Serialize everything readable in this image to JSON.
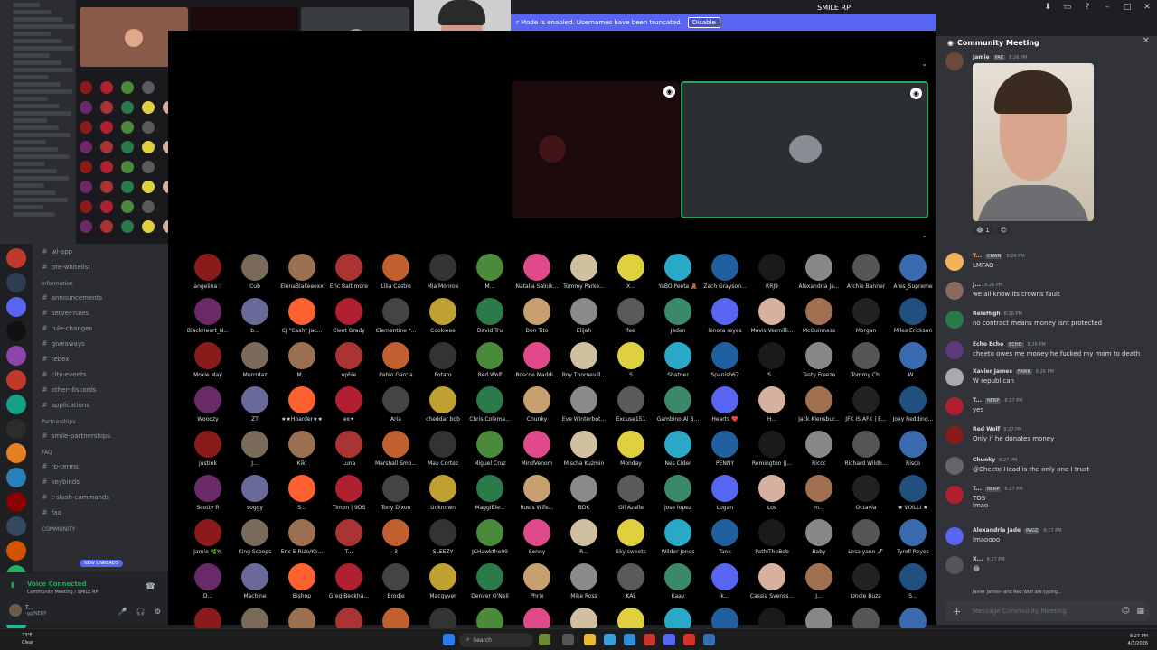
{
  "titlebar": {
    "title": "SMILE RP"
  },
  "streamer_banner": {
    "text": "r Mode is enabled. Usernames have been truncated.",
    "button": "Disable"
  },
  "channels": {
    "items": [
      {
        "name": "wl-app",
        "kind": "ch"
      },
      {
        "name": "pre-whitelist",
        "kind": "ch"
      },
      {
        "name": "Information",
        "kind": "cat"
      },
      {
        "name": "announcements",
        "kind": "ch"
      },
      {
        "name": "server-rules",
        "kind": "ch"
      },
      {
        "name": "rule-changes",
        "kind": "ch"
      },
      {
        "name": "giveaways",
        "kind": "ch"
      },
      {
        "name": "tebex",
        "kind": "ch"
      },
      {
        "name": "city-events",
        "kind": "ch"
      },
      {
        "name": "other-discords",
        "kind": "ch"
      },
      {
        "name": "applications",
        "kind": "ch"
      },
      {
        "name": "Partnerships",
        "kind": "cat"
      },
      {
        "name": "smile-partnerships",
        "kind": "ch"
      },
      {
        "name": "FAQ",
        "kind": "cat"
      },
      {
        "name": "rp-terms",
        "kind": "ch"
      },
      {
        "name": "keybinds",
        "kind": "ch"
      },
      {
        "name": "t-slash-commands",
        "kind": "ch"
      },
      {
        "name": "faq",
        "kind": "ch"
      },
      {
        "name": "COMMUNITY",
        "kind": "cat"
      }
    ],
    "new_unreads": "NEW UNREADS"
  },
  "voice": {
    "status": "Voice Connected",
    "channel": "Community Meeting / SMILE RP",
    "user": "T...",
    "user_sub": "-gg/NERP"
  },
  "participants": [
    "angelina♡",
    "Cub",
    "ElenaBlakeeexx",
    "Eric Baltimore",
    "Lilia Castro",
    "Mia Monroe",
    "M...",
    "Natalia Salnik...",
    "Tommy Parke...",
    "X...",
    "YaBOIPeeta 🧸",
    "Zach Grayson...",
    "RRJ9",
    "Alexandria Ja...",
    "Archie Banner",
    "Ares_Supreme",
    "BlackHeart_N...",
    "b...",
    "CJ \"Cash\" Jac...",
    "Cleet Grady",
    "Clementine *...",
    "Cookieee",
    "David Tru",
    "Don Tito",
    "Elijah",
    "fee",
    "Jaden",
    "lenora reyes",
    "Mavis Vermilli...",
    "McGuinness",
    "Morgan",
    "Miles Erickson",
    "Moxie May",
    "Murrrdaz",
    "M...",
    "ophie",
    "Pablo Garcia",
    "Potato",
    "Red Wolf",
    "Roscoe Maddi...",
    "Roy Thornevill...",
    "S",
    "Shatner",
    "Spanish67",
    "S...",
    "Tasty Freeze",
    "Tommy Chi",
    "W...",
    "Woodzy",
    "ZT",
    "★★Hoarder★★",
    "ex✦",
    "Aria",
    "cheddar bob",
    "Chris Colema...",
    "Chunky",
    "Eve Winterbot...",
    "Excuse151",
    "Gambino Al B...",
    "Hearts ❤️",
    "H...",
    "Jack Klensbur...",
    "JFK IS AFK | E...",
    "Joey Redding...",
    "justink",
    "J...",
    "Kiki",
    "Luna",
    "Marshall Smo...",
    "Max Cortez",
    "Miguel Cruz",
    "MindVenom",
    "Mischa Kuzmin",
    "Monday",
    "Nes Cider",
    "PENNY",
    "Remington ||...",
    "Riccc",
    "Richard Wildh...",
    "Risco",
    "Scotty R",
    "soggy",
    "S...",
    "Timon | 9DS",
    "Tony Dixon",
    "Unknown",
    "MaggiBle...",
    "Rue's Wife...",
    "BDK",
    "Gil Azalle",
    "jose lopez",
    "Logan",
    "Los",
    "m...",
    "Octavia",
    "★ WXLLI ★",
    "Jamie 🌿%",
    "King Scoops",
    "Eric E Rizo/Ke...",
    "T...",
    "3",
    "SLEEZY",
    "JCHawkthe99",
    "Sonny",
    "R...",
    "Sky sweets",
    "Wilder Jones",
    "Tank",
    "PathiTheBob",
    "Baby",
    "Lesaiyann 🦨",
    "Tyrell Reyes",
    "D...",
    "Machine",
    "Bishop",
    "Greg Beckha...",
    "Brodie",
    "Macgyver",
    "Denver O'Neil",
    "Phrix",
    "Mike Ross",
    "KAL",
    "Kaav",
    "k...",
    "Cassia Svenss...",
    "J...",
    "Uncle Buzz",
    "S...",
    "",
    "",
    "",
    "",
    "",
    "",
    "",
    "",
    "",
    "",
    "",
    "",
    "",
    "",
    "",
    ""
  ],
  "chat": {
    "title": "Community Meeting",
    "top_msg": {
      "user": "Jamie",
      "tag": "PAC",
      "time": "8:26 PM"
    },
    "reaction_count": "1",
    "messages": [
      {
        "user": "T...",
        "tag": "CRWN",
        "time": "8:26 PM",
        "text": "LMFAO",
        "color": "#f2b35b"
      },
      {
        "user": "J...",
        "tag": "",
        "time": "8:26 PM",
        "text": "we all know its crowns fault",
        "color": "#dbdee1"
      },
      {
        "user": "ReIeHigh",
        "tag": "",
        "time": "8:26 PM",
        "text": "no contract means money isnt protected",
        "color": "#dbdee1"
      },
      {
        "user": "Echo Echo",
        "tag": "ECHO",
        "time": "8:26 PM",
        "text": "cheeto owes me money he fucked my mom to death",
        "color": "#dbdee1"
      },
      {
        "user": "Xavier James",
        "tag": "FAWK",
        "time": "8:26 PM",
        "text": "W republican",
        "color": "#dbdee1"
      },
      {
        "user": "T...",
        "tag": "NERP",
        "time": "8:27 PM",
        "text": "yes",
        "color": "#dbdee1"
      },
      {
        "user": "Red Wolf",
        "tag": "",
        "time": "8:27 PM",
        "text": "Only if he donates money",
        "color": "#dbdee1"
      },
      {
        "user": "Chunky",
        "tag": "",
        "time": "8:27 PM",
        "text": "@Cheeto Head is the only one I trust",
        "color": "#dbdee1"
      },
      {
        "user": "T...",
        "tag": "NERP",
        "time": "8:27 PM",
        "text": "TOS",
        "color": "#dbdee1"
      },
      {
        "user": "",
        "tag": "",
        "time": "",
        "text": "lmao",
        "color": "#dbdee1"
      },
      {
        "user": "Alexandria Jade",
        "tag": "PAGZ",
        "time": "8:27 PM",
        "text": "lmaoooo",
        "color": "#dbdee1"
      },
      {
        "user": "X...",
        "tag": "",
        "time": "8:27 PM",
        "text": "😂",
        "color": "#dbdee1"
      }
    ],
    "typing": "Javier James- and Red Wolf are typing...",
    "composer_placeholder": "Message Community Meeting"
  },
  "taskbar": {
    "weather": "73°F",
    "weather_sub": "Clear",
    "search": "Search",
    "time": "8:27 PM",
    "date": "4/2/2026"
  },
  "colors": {
    "accent": "#5865f2",
    "online": "#23a55a",
    "bg": "#313338"
  }
}
